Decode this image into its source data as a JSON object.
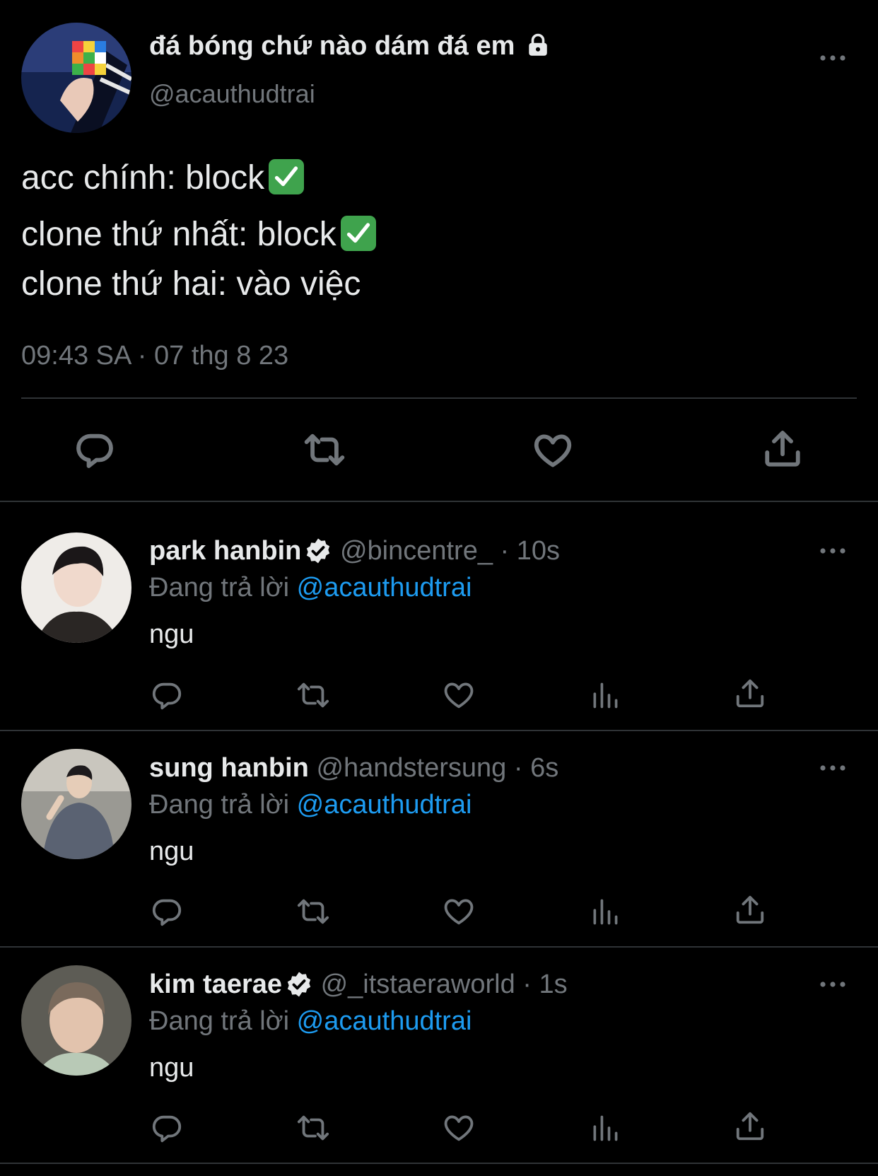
{
  "main_tweet": {
    "display_name": "đá bóng chứ nào dám đá em",
    "handle": "@acauthudtrai",
    "lines": [
      "acc chính: block",
      "clone thứ nhất: block",
      "clone thứ hai: vào việc"
    ],
    "timestamp": "09:43 SA · 07 thg 8 23",
    "avatar_colors": [
      "#1c2a55",
      "#3a4f8f"
    ]
  },
  "replies": [
    {
      "name": "park hanbin",
      "verified": true,
      "handle": "@bincentre_",
      "time": "· 10s",
      "replying_prefix": "Đang trả lời",
      "replying_to": "@acauthudtrai",
      "text": "ngu",
      "avatar_colors": [
        "#e8e4df",
        "#2b2623"
      ]
    },
    {
      "name": "sung hanbin",
      "verified": false,
      "handle": "@handstersung",
      "time": "· 6s",
      "replying_prefix": "Đang trả lời",
      "replying_to": "@acauthudtrai",
      "text": "ngu",
      "avatar_colors": [
        "#8d8c86",
        "#4a4e58"
      ]
    },
    {
      "name": "kim taerae",
      "verified": true,
      "handle": "@_itstaeraworld",
      "time": "· 1s",
      "replying_prefix": "Đang trả lời",
      "replying_to": "@acauthudtrai",
      "text": "ngu",
      "avatar_colors": [
        "#5f5e57",
        "#cfb19b"
      ]
    }
  ],
  "colors": {
    "background": "#000000",
    "text": "#e7e9ea",
    "muted": "#71767b",
    "link": "#1d9bf0",
    "divider": "#2f3336"
  },
  "icons": [
    "lock-icon",
    "more-icon",
    "reply-icon",
    "retweet-icon",
    "like-icon",
    "share-icon",
    "views-icon",
    "verified-badge-icon",
    "check-mark-emoji"
  ]
}
